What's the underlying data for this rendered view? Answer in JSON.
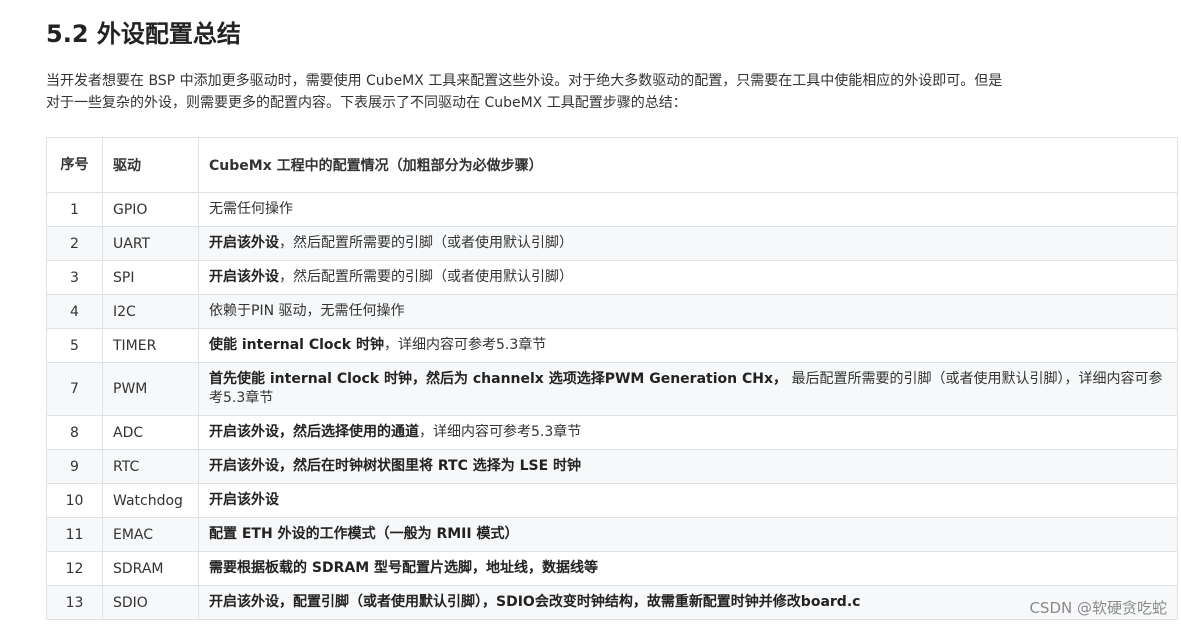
{
  "heading": "5.2 外设配置总结",
  "intro": {
    "line1": "当开发者想要在 BSP 中添加更多驱动时，需要使用 CubeMX 工具来配置这些外设。对于绝大多数驱动的配置，只需要在工具中使能相应的外设即可。但是",
    "line2": "对于一些复杂的外设，则需要更多的配置内容。下表展示了不同驱动在 CubeMX 工具配置步骤的总结："
  },
  "table": {
    "headers": {
      "num": "序号",
      "driver": "驱动",
      "config": "CubeMx 工程中的配置情况（加粗部分为必做步骤）"
    },
    "rows": [
      {
        "num": "1",
        "driver": "GPIO",
        "bold": "",
        "rest": "无需任何操作"
      },
      {
        "num": "2",
        "driver": "UART",
        "bold": "开启该外设",
        "rest": "，然后配置所需要的引脚（或者使用默认引脚）"
      },
      {
        "num": "3",
        "driver": "SPI",
        "bold": "开启该外设",
        "rest": "，然后配置所需要的引脚（或者使用默认引脚）"
      },
      {
        "num": "4",
        "driver": "I2C",
        "bold": "",
        "rest": "依赖于PIN 驱动，无需任何操作"
      },
      {
        "num": "5",
        "driver": "TIMER",
        "bold": "使能 internal Clock 时钟",
        "rest": "，详细内容可参考5.3章节"
      },
      {
        "num": "7",
        "driver": "PWM",
        "bold": "首先使能 internal Clock 时钟，然后为 channelx 选项选择PWM Generation CHx，",
        "rest": " 最后配置所需要的引脚（或者使用默认引脚），详细内容可参考5.3章节"
      },
      {
        "num": "8",
        "driver": "ADC",
        "bold": "开启该外设，然后选择使用的通道",
        "rest": "，详细内容可参考5.3章节"
      },
      {
        "num": "9",
        "driver": "RTC",
        "bold": "开启该外设，然后在时钟树状图里将 RTC 选择为 LSE 时钟",
        "rest": ""
      },
      {
        "num": "10",
        "driver": "Watchdog",
        "bold": "开启该外设",
        "rest": ""
      },
      {
        "num": "11",
        "driver": "EMAC",
        "bold": "配置 ETH 外设的工作模式（一般为 RMII 模式）",
        "rest": ""
      },
      {
        "num": "12",
        "driver": "SDRAM",
        "bold": "需要根据板载的 SDRAM 型号配置片选脚，地址线，数据线等",
        "rest": ""
      },
      {
        "num": "13",
        "driver": "SDIO",
        "bold": "开启该外设，配置引脚（或者使用默认引脚），SDIO会改变时钟结构，故需重新配置时钟并修改board.c",
        "rest": ""
      }
    ]
  },
  "watermark": "CSDN @软硬贪吃蛇"
}
